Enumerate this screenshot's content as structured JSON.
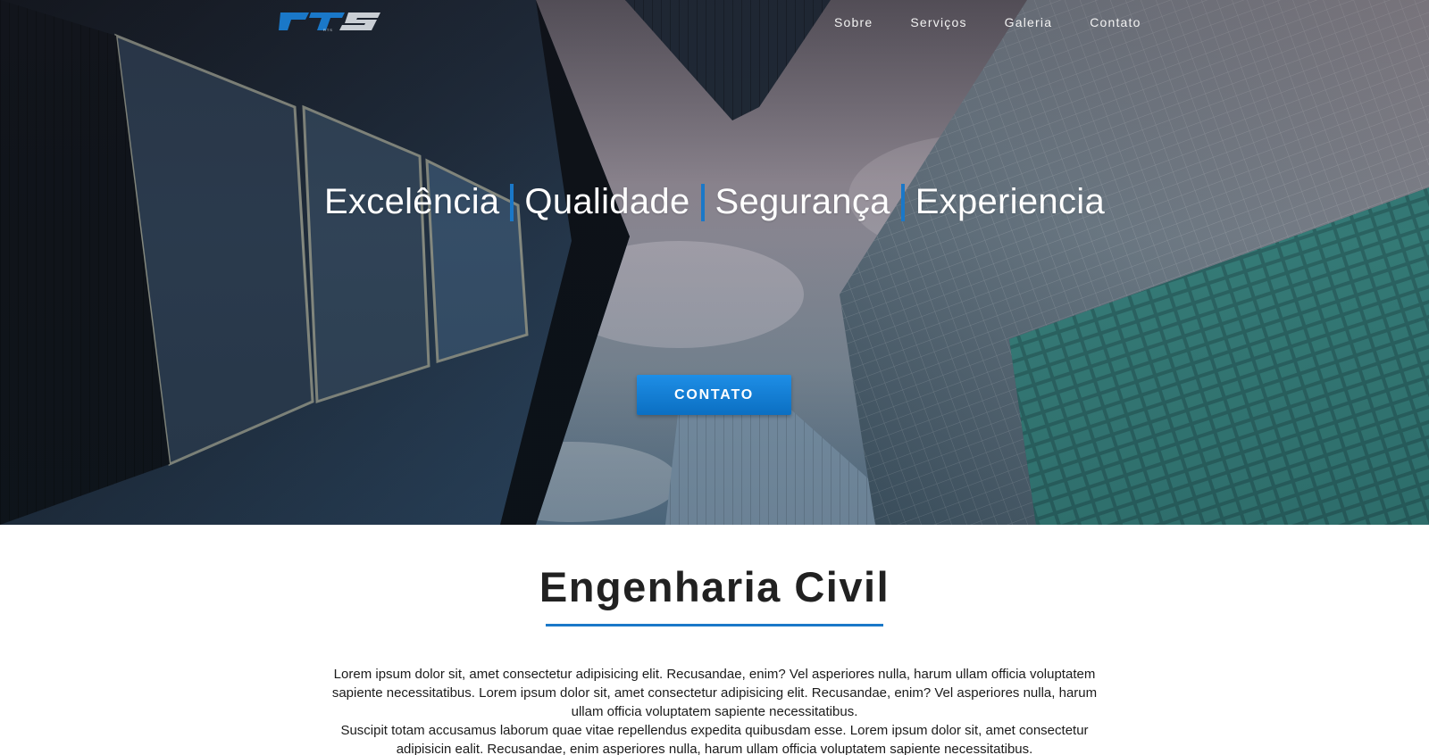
{
  "brand": {
    "logo_text": "RTS",
    "accent_color": "#1a78c8"
  },
  "nav": {
    "items": [
      "Sobre",
      "Serviços",
      "Galeria",
      "Contato"
    ]
  },
  "hero": {
    "words": [
      "Excelência",
      "Qualidade",
      "Segurança",
      "Experiencia"
    ],
    "cta_label": "CONTATO",
    "cta_color": "#1584db"
  },
  "section": {
    "title": "Engenharia Civil",
    "paragraphs": [
      "Lorem ipsum dolor sit, amet consectetur adipisicing elit. Recusandae, enim? Vel asperiores nulla, harum ullam officia voluptatem sapiente necessitatibus. Lorem ipsum dolor sit, amet consectetur adipisicing elit. Recusandae, enim? Vel asperiores nulla, harum ullam officia voluptatem sapiente necessitatibus.",
      "Suscipit totam accusamus laborum quae vitae repellendus expedita quibusdam esse. Lorem ipsum dolor sit, amet consectetur adipisicin ealit. Recusandae, enim asperiores nulla, harum ullam officia voluptatem sapiente necessitatibus."
    ]
  }
}
